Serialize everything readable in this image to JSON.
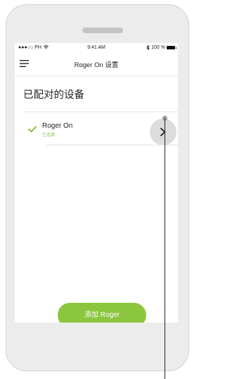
{
  "status_bar": {
    "carrier": "●●●○○ PH",
    "time": "9:41 AM",
    "battery": "100 %"
  },
  "nav": {
    "title": "Roger On 设置"
  },
  "page": {
    "title": "已配对的设备"
  },
  "devices": [
    {
      "name": "Roger On",
      "status": "已连接"
    }
  ],
  "actions": {
    "add_label": "添加 Roger"
  },
  "colors": {
    "accent": "#8cc63e",
    "phone_frame": "#ececec",
    "chevron_bg": "#dcdcdc"
  },
  "icons": {
    "menu": "hamburger-menu-icon",
    "check": "check-icon",
    "chevron": "chevron-right-icon",
    "wifi": "wifi-icon",
    "bluetooth": "bluetooth-icon",
    "battery": "battery-icon"
  }
}
